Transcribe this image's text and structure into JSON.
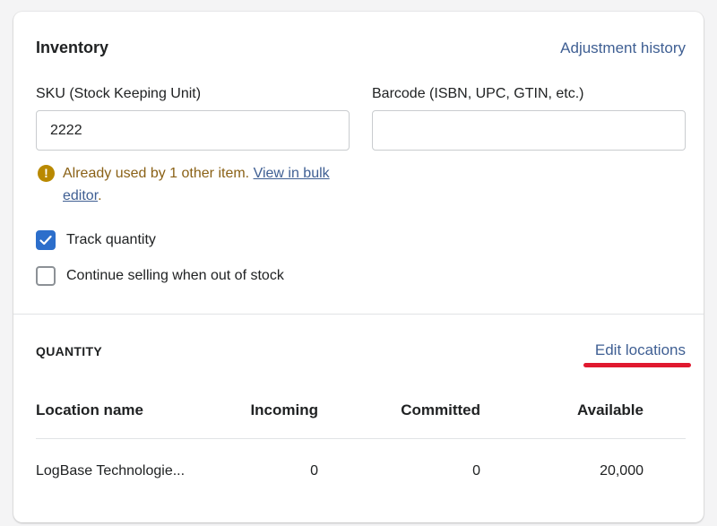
{
  "inventory": {
    "title": "Inventory",
    "adjustment_history_link": "Adjustment history",
    "sku": {
      "label": "SKU (Stock Keeping Unit)",
      "value": "2222"
    },
    "barcode": {
      "label": "Barcode (ISBN, UPC, GTIN, etc.)",
      "value": ""
    },
    "warning": {
      "icon": "exclamation-circle-icon",
      "text": "Already used by 1 other item. ",
      "link": "View in bulk editor",
      "suffix": "."
    },
    "checkboxes": [
      {
        "label": "Track quantity",
        "checked": true
      },
      {
        "label": "Continue selling when out of stock",
        "checked": false
      }
    ]
  },
  "quantity": {
    "heading": "QUANTITY",
    "edit_locations_link": "Edit locations",
    "table": {
      "columns": [
        "Location name",
        "Incoming",
        "Committed",
        "Available"
      ],
      "rows": [
        {
          "location": "LogBase Technologie...",
          "incoming": "0",
          "committed": "0",
          "available": "20,000"
        }
      ]
    }
  },
  "colors": {
    "link": "#3f5f93",
    "warning_text": "#8a6116",
    "warning_icon": "#b98900",
    "checkbox_checked": "#2c6ecb",
    "annotation_underline": "#e0192f"
  }
}
